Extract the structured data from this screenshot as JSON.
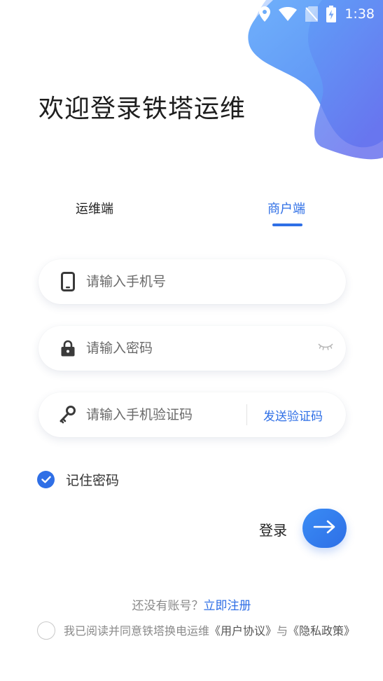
{
  "status_bar": {
    "time": "1:38",
    "icons": [
      "location-icon",
      "wifi-icon",
      "no-sim-icon",
      "battery-charging-icon"
    ]
  },
  "page": {
    "title": "欢迎登录铁塔运维"
  },
  "tabs": [
    {
      "label": "运维端",
      "selected": false
    },
    {
      "label": "商户端",
      "selected": true
    }
  ],
  "form": {
    "phone": {
      "placeholder": "请输入手机号",
      "value": "",
      "icon": "phone-icon"
    },
    "password": {
      "placeholder": "请输入密码",
      "value": "",
      "icon": "lock-icon",
      "toggle_icon": "eye-closed-icon"
    },
    "sms_code": {
      "placeholder": "请输入手机验证码",
      "value": "",
      "icon": "key-icon",
      "send_label": "发送验证码"
    },
    "remember": {
      "label": "记住密码",
      "checked": true
    }
  },
  "login": {
    "label": "登录",
    "button_icon": "arrow-right-icon"
  },
  "register": {
    "question": "还没有账号？",
    "link": "立即注册"
  },
  "agreement": {
    "checked": false,
    "prefix": "我已阅读并同意铁塔换电运维",
    "user_agreement": "《用户协议》",
    "connector": "与",
    "privacy_policy": "《隐私政策》"
  },
  "colors": {
    "accent": "#2f6fe6",
    "blob_light": "#a9ccff",
    "blob_mid": "#64a4f9",
    "blob_dark": "#5b7bef"
  }
}
